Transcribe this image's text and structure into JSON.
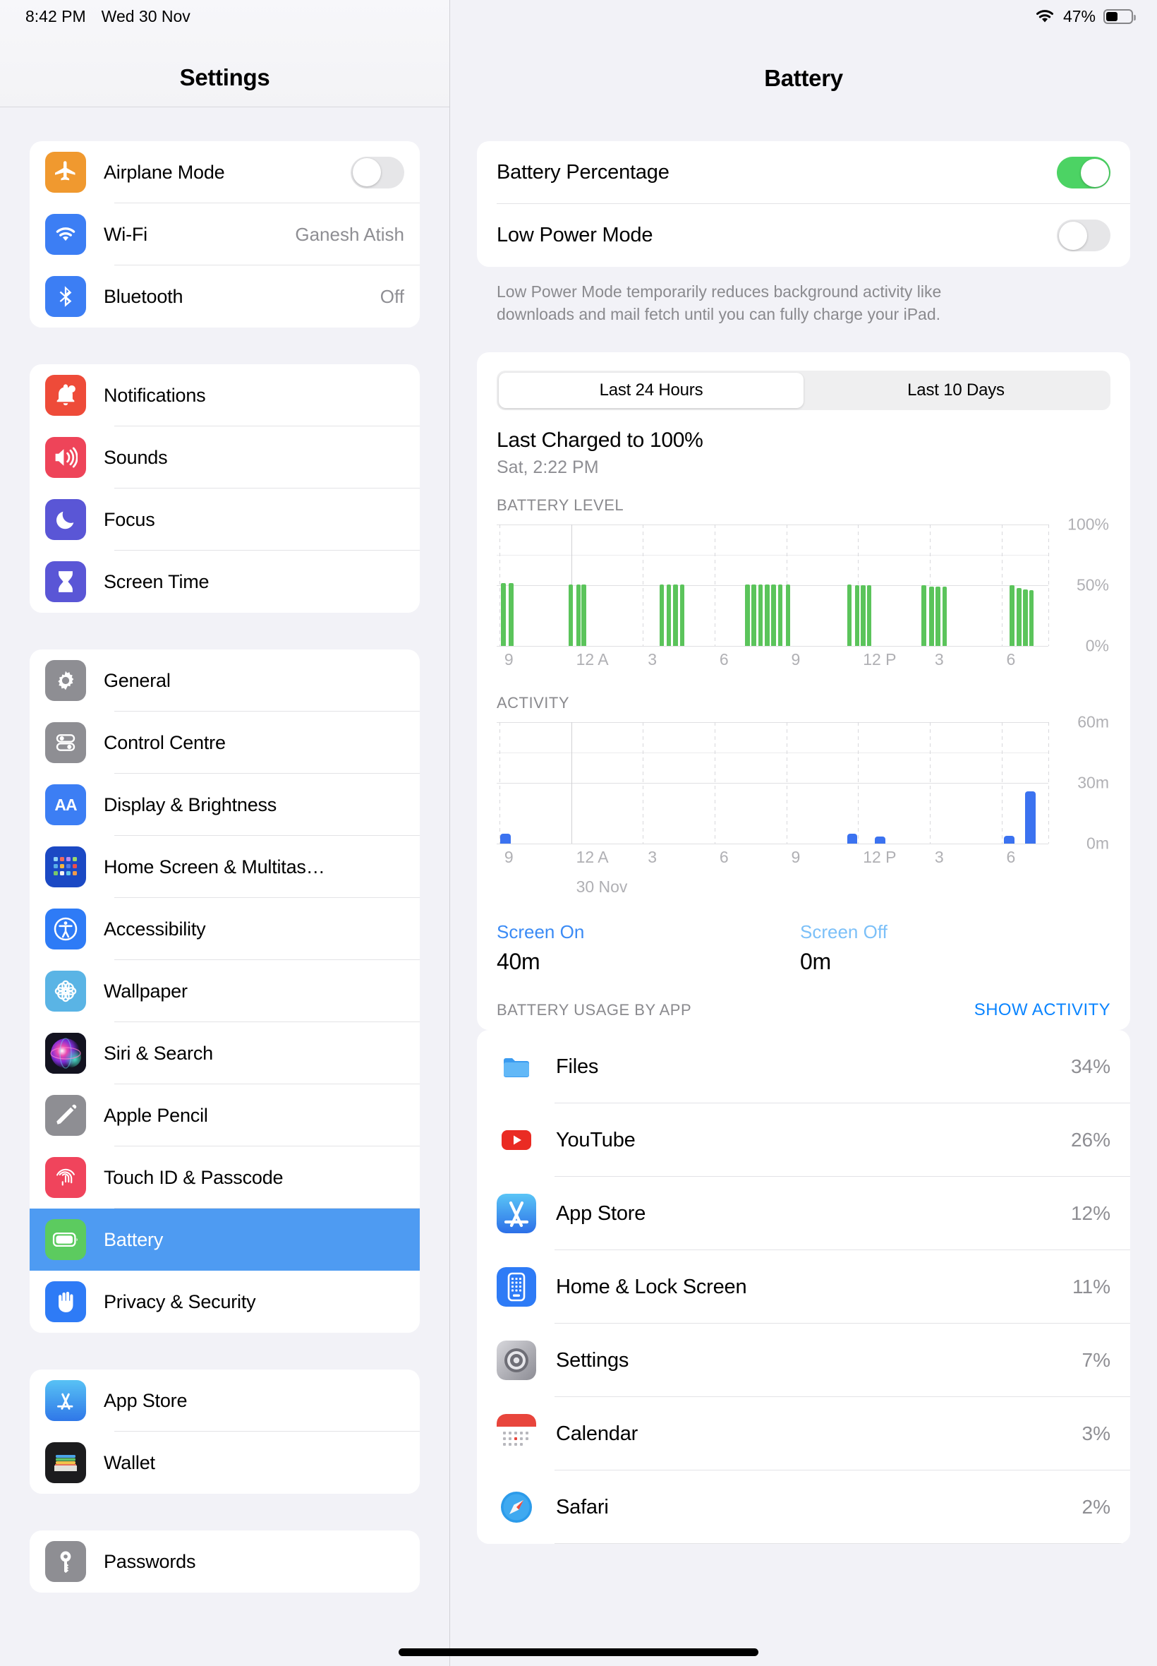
{
  "status_bar": {
    "time": "8:42 PM",
    "date": "Wed 30 Nov",
    "battery_percent": "47%",
    "battery_level": 47,
    "wifi_icon": "wifi-icon",
    "battery_icon": "battery-icon"
  },
  "sidebar": {
    "title": "Settings",
    "groups": [
      {
        "items": [
          {
            "label": "Airplane Mode",
            "icon": "airplane-icon",
            "icon_color": "#F0992F",
            "control": "toggle",
            "toggle_on": false
          },
          {
            "label": "Wi-Fi",
            "icon": "wifi-icon",
            "icon_color": "#3C7EF4",
            "value": "Ganesh Atish"
          },
          {
            "label": "Bluetooth",
            "icon": "bluetooth-icon",
            "icon_color": "#3C7EF4",
            "value": "Off"
          }
        ]
      },
      {
        "items": [
          {
            "label": "Notifications",
            "icon": "bell-icon",
            "icon_color": "#EE4B39"
          },
          {
            "label": "Sounds",
            "icon": "speaker-icon",
            "icon_color": "#EE4459"
          },
          {
            "label": "Focus",
            "icon": "moon-icon",
            "icon_color": "#5A56D6"
          },
          {
            "label": "Screen Time",
            "icon": "hourglass-icon",
            "icon_color": "#5A56D6"
          }
        ]
      },
      {
        "items": [
          {
            "label": "General",
            "icon": "gear-icon",
            "icon_color": "#8E8E93"
          },
          {
            "label": "Control Centre",
            "icon": "control-centre-icon",
            "icon_color": "#8E8E93"
          },
          {
            "label": "Display & Brightness",
            "icon": "display-brightness-icon",
            "icon_color": "#3C7EF4"
          },
          {
            "label": "Home Screen & Multitas…",
            "icon": "home-screen-grid-icon",
            "icon_color": "#1B49C4"
          },
          {
            "label": "Accessibility",
            "icon": "accessibility-icon",
            "icon_color": "#2E7BF6"
          },
          {
            "label": "Wallpaper",
            "icon": "wallpaper-flower-icon",
            "icon_color": "#5AB4E5"
          },
          {
            "label": "Siri & Search",
            "icon": "siri-icon",
            "icon_color": "#1A1A24"
          },
          {
            "label": "Apple Pencil",
            "icon": "pencil-icon",
            "icon_color": "#8E8E93"
          },
          {
            "label": "Touch ID & Passcode",
            "icon": "fingerprint-icon",
            "icon_color": "#F0445C"
          },
          {
            "label": "Battery",
            "icon": "battery-icon",
            "icon_color": "#5CCB5F",
            "selected": true
          },
          {
            "label": "Privacy & Security",
            "icon": "hand-icon",
            "icon_color": "#2E7BF6"
          }
        ]
      },
      {
        "items": [
          {
            "label": "App Store",
            "icon": "app-store-icon",
            "icon_color": "#3B8BF0"
          },
          {
            "label": "Wallet",
            "icon": "wallet-icon",
            "icon_color": "#1C1C1E"
          }
        ]
      },
      {
        "items": [
          {
            "label": "Passwords",
            "icon": "key-icon",
            "icon_color": "#8E8E93"
          }
        ]
      }
    ],
    "selected_highlight_color": "#4E9BF2"
  },
  "detail": {
    "title": "Battery",
    "toggles": [
      {
        "label": "Battery Percentage",
        "on": true
      },
      {
        "label": "Low Power Mode",
        "on": false
      }
    ],
    "footnote": "Low Power Mode temporarily reduces background activity like downloads and mail fetch until you can fully charge your iPad.",
    "segments": [
      {
        "label": "Last 24 Hours",
        "active": true
      },
      {
        "label": "Last 10 Days",
        "active": false
      }
    ],
    "last_charged_title": "Last Charged to 100%",
    "last_charged_sub": "Sat, 2:22 PM",
    "screen_on": {
      "label": "Screen On",
      "value": "40m",
      "color": "#3B8BF5"
    },
    "screen_off": {
      "label": "Screen Off",
      "value": "0m",
      "color": "#7CC0F8"
    },
    "usage_header": "BATTERY USAGE BY APP",
    "show_activity": "SHOW ACTIVITY",
    "apps": [
      {
        "name": "Files",
        "percent": "34%",
        "icon": "files-icon"
      },
      {
        "name": "YouTube",
        "percent": "26%",
        "icon": "youtube-icon"
      },
      {
        "name": "App Store",
        "percent": "12%",
        "icon": "app-store-icon"
      },
      {
        "name": "Home & Lock Screen",
        "percent": "11%",
        "icon": "home-lock-screen-icon"
      },
      {
        "name": "Settings",
        "percent": "7%",
        "icon": "settings-gear-icon"
      },
      {
        "name": "Calendar",
        "percent": "3%",
        "icon": "calendar-icon"
      },
      {
        "name": "Safari",
        "percent": "2%",
        "icon": "safari-icon"
      }
    ]
  },
  "chart_data": [
    {
      "type": "bar",
      "title": "BATTERY LEVEL",
      "ylabel": "",
      "xlabel": "",
      "ylim": [
        0,
        100
      ],
      "ytick_labels": [
        "0%",
        "50%",
        "100%"
      ],
      "ytick_values": [
        0,
        50,
        100
      ],
      "xtick_labels": [
        "9",
        "12 A",
        "3",
        "6",
        "9",
        "12 P",
        "3",
        "6"
      ],
      "xtick_positions": [
        0.5,
        13.5,
        26.5,
        39.5,
        52.5,
        65.5,
        78.5,
        91.5
      ],
      "bar_color": "#5BC45B",
      "grid": true,
      "values": [
        {
          "x": 0.8,
          "y": 52
        },
        {
          "x": 2.2,
          "y": 52
        },
        {
          "x": 13.0,
          "y": 51
        },
        {
          "x": 14.4,
          "y": 51
        },
        {
          "x": 15.4,
          "y": 51
        },
        {
          "x": 29.5,
          "y": 51
        },
        {
          "x": 30.8,
          "y": 51
        },
        {
          "x": 32.0,
          "y": 51
        },
        {
          "x": 33.2,
          "y": 51
        },
        {
          "x": 45.0,
          "y": 51
        },
        {
          "x": 46.2,
          "y": 51
        },
        {
          "x": 47.4,
          "y": 51
        },
        {
          "x": 48.6,
          "y": 51
        },
        {
          "x": 49.8,
          "y": 51
        },
        {
          "x": 51.0,
          "y": 51
        },
        {
          "x": 52.4,
          "y": 51
        },
        {
          "x": 63.5,
          "y": 51
        },
        {
          "x": 64.9,
          "y": 50
        },
        {
          "x": 66.0,
          "y": 50
        },
        {
          "x": 67.1,
          "y": 50
        },
        {
          "x": 77.0,
          "y": 50
        },
        {
          "x": 78.4,
          "y": 49
        },
        {
          "x": 79.6,
          "y": 49
        },
        {
          "x": 80.8,
          "y": 49
        },
        {
          "x": 93.0,
          "y": 50
        },
        {
          "x": 94.3,
          "y": 48
        },
        {
          "x": 95.4,
          "y": 47
        },
        {
          "x": 96.5,
          "y": 46
        }
      ]
    },
    {
      "type": "bar",
      "title": "ACTIVITY",
      "ylabel": "",
      "xlabel": "30 Nov",
      "ylim": [
        0,
        60
      ],
      "ytick_labels": [
        "0m",
        "30m",
        "60m"
      ],
      "ytick_values": [
        0,
        30,
        60
      ],
      "xtick_labels": [
        "9",
        "12 A",
        "3",
        "6",
        "9",
        "12 P",
        "3",
        "6"
      ],
      "xtick_positions": [
        0.5,
        13.5,
        26.5,
        39.5,
        52.5,
        65.5,
        78.5,
        91.5
      ],
      "bar_color": "#3B72F0",
      "grid": true,
      "values": [
        {
          "x": 0.7,
          "y": 5
        },
        {
          "x": 63.5,
          "y": 5
        },
        {
          "x": 68.5,
          "y": 3.5
        },
        {
          "x": 92.0,
          "y": 4
        },
        {
          "x": 95.8,
          "y": 26
        }
      ]
    }
  ]
}
